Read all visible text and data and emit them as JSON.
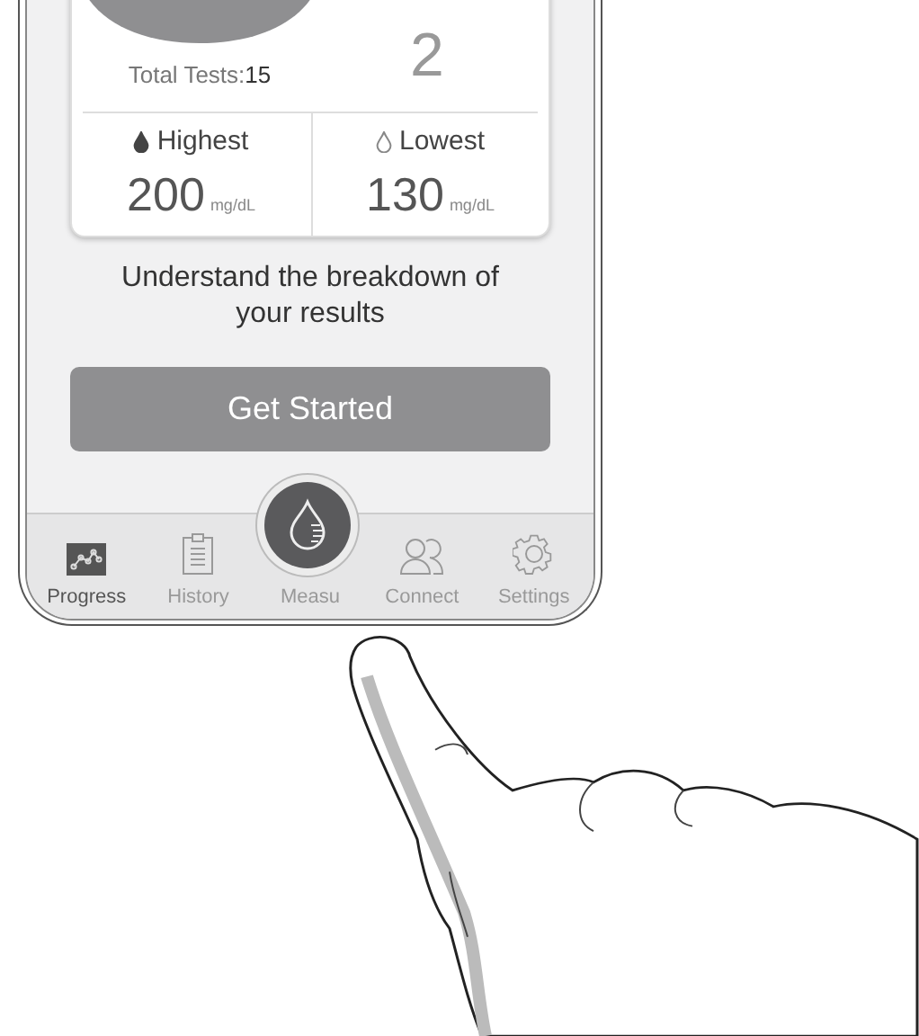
{
  "summary": {
    "total_tests_label": "Total Tests:",
    "total_tests": "15",
    "lows_count": "2"
  },
  "stats": [
    {
      "kind": "filled",
      "label": "Highest",
      "value": "200",
      "unit": "mg/dL"
    },
    {
      "kind": "outline",
      "label": "Lowest",
      "value": "130",
      "unit": "mg/dL"
    }
  ],
  "prompt": "Understand the breakdown of your results",
  "button": "Get Started",
  "tabs": [
    {
      "kind": "chart",
      "label": "Progress",
      "selected": true
    },
    {
      "kind": "clipboard",
      "label": "History",
      "selected": false
    },
    {
      "kind": "drop",
      "label": "Measu",
      "selected": false
    },
    {
      "kind": "people",
      "label": "Connect",
      "selected": false
    },
    {
      "kind": "gear",
      "label": "Settings",
      "selected": false
    }
  ]
}
